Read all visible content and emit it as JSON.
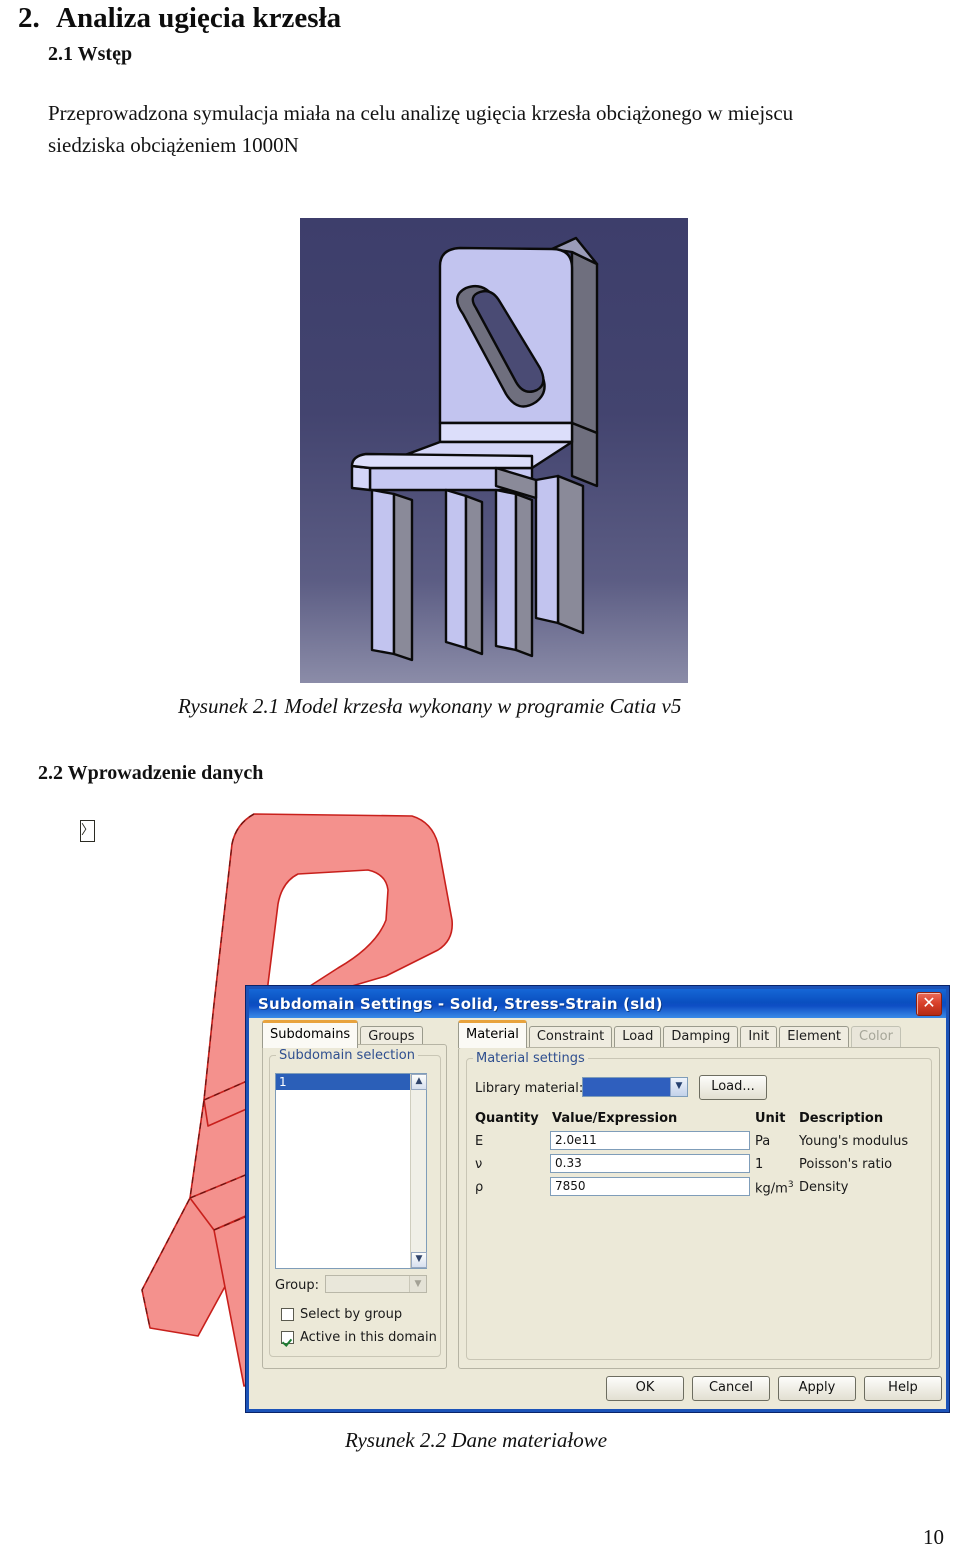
{
  "document": {
    "chapter_number": "2.",
    "chapter_title": "Analiza ugięcia krzesła",
    "section_1_heading": "2.1 Wstęp",
    "section_1_paragraph": "Przeprowadzona symulacja miała na celu analizę ugięcia krzesła obciążonego w miejscu siedziska obciążeniem 1000N",
    "figure_1_caption": "Rysunek 2.1 Model krzesła wykonany w programie Catia v5",
    "section_2_heading": "2.2 Wprowadzenie danych",
    "missing_glyph": "〉",
    "figure_2_caption": "Rysunek 2.2 Dane materiałowe",
    "page_number": "10"
  },
  "figure_1": {
    "name": "catia-chair-viewport",
    "background_top": "#3d3e6b",
    "background_bottom": "#8b8ca8",
    "face_light": "#c2c4ef",
    "face_dark": "#6f6f7e",
    "outline": "#0a0a0a"
  },
  "figure_2": {
    "red_geometry_fill": "#f4918d",
    "red_geometry_stroke": "#c8201c"
  },
  "dialog": {
    "title": "Subdomain Settings - Solid, Stress-Strain (sld)",
    "close_label": "✕",
    "accent_titlebar": "#0a4fc0",
    "accent_tab": "#e8a33d",
    "left_tabs": [
      {
        "label": "Subdomains",
        "active": true
      },
      {
        "label": "Groups",
        "active": false
      }
    ],
    "right_tabs": [
      {
        "label": "Material",
        "active": true,
        "disabled": false
      },
      {
        "label": "Constraint",
        "active": false,
        "disabled": false
      },
      {
        "label": "Load",
        "active": false,
        "disabled": false
      },
      {
        "label": "Damping",
        "active": false,
        "disabled": false
      },
      {
        "label": "Init",
        "active": false,
        "disabled": false
      },
      {
        "label": "Element",
        "active": false,
        "disabled": false
      },
      {
        "label": "Color",
        "active": false,
        "disabled": true
      }
    ],
    "left_panel": {
      "group_title": "Subdomain selection",
      "list_items": [
        {
          "label": "1",
          "selected": true
        }
      ],
      "group_label": "Group:",
      "group_value": "",
      "select_by_group": {
        "label": "Select by group",
        "checked": false
      },
      "active_in_domain": {
        "label": "Active in this domain",
        "checked": true
      }
    },
    "right_panel": {
      "group_title": "Material settings",
      "library_label": "Library material:",
      "library_value": "",
      "load_button": "Load...",
      "columns": [
        "Quantity",
        "Value/Expression",
        "Unit",
        "Description"
      ],
      "rows": [
        {
          "quantity": "E",
          "value": "2.0e11",
          "unit": "Pa",
          "unit_sup": "",
          "description": "Young's modulus"
        },
        {
          "quantity": "ν",
          "value": "0.33",
          "unit": "1",
          "unit_sup": "",
          "description": "Poisson's ratio"
        },
        {
          "quantity": "ρ",
          "value": "7850",
          "unit": "kg/m",
          "unit_sup": "3",
          "description": "Density"
        }
      ]
    },
    "buttons": [
      {
        "label": "OK"
      },
      {
        "label": "Cancel"
      },
      {
        "label": "Apply"
      },
      {
        "label": "Help"
      }
    ]
  }
}
